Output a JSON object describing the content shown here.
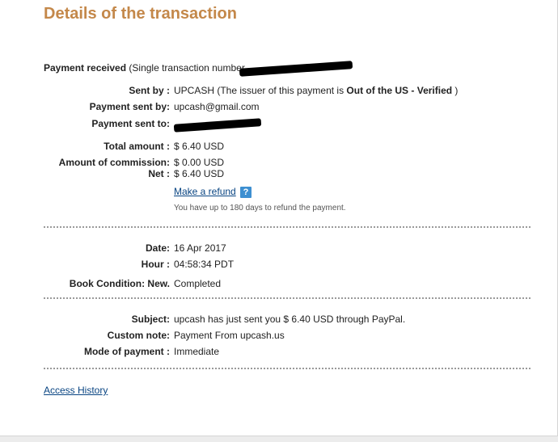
{
  "title": "Details of the transaction",
  "payment_received": {
    "label": "Payment received",
    "detail_prefix": "(Single transaction number"
  },
  "details": {
    "sent_by": {
      "label": "Sent by :",
      "value_prefix": "UPCASH (The issuer of this payment is ",
      "value_bold": "Out of the US - Verified",
      "value_suffix": " )"
    },
    "payment_sent_by": {
      "label": "Payment sent by:",
      "value": "upcash@gmail.com"
    },
    "payment_sent_to": {
      "label": "Payment sent to:"
    },
    "total_amount": {
      "label": "Total amount :",
      "value": "$ 6.40 USD"
    },
    "commission": {
      "label": "Amount of commission:",
      "value": "$ 0.00 USD"
    },
    "net": {
      "label": "Net :",
      "value": "$ 6.40 USD"
    }
  },
  "refund": {
    "link_label": "Make a refund",
    "help_icon": "?",
    "note": "You have up to 180 days to refund the payment."
  },
  "timing": {
    "date": {
      "label": "Date:",
      "value": "16 Apr 2017"
    },
    "hour": {
      "label": "Hour :",
      "value": "04:58:34 PDT"
    },
    "condition": {
      "label": "Book Condition: New.",
      "value": "Completed"
    }
  },
  "message": {
    "subject": {
      "label": "Subject:",
      "value": "upcash has just sent you $ 6.40 USD through PayPal."
    },
    "custom_note": {
      "label": "Custom note:",
      "value": "Payment From upcash.us"
    },
    "mode": {
      "label": "Mode of payment :",
      "value": "Immediate"
    }
  },
  "footer": {
    "access_history": "Access History"
  },
  "colors": {
    "title": "#c4884a",
    "link": "#084482",
    "help_icon_bg": "#3d8fd1"
  }
}
